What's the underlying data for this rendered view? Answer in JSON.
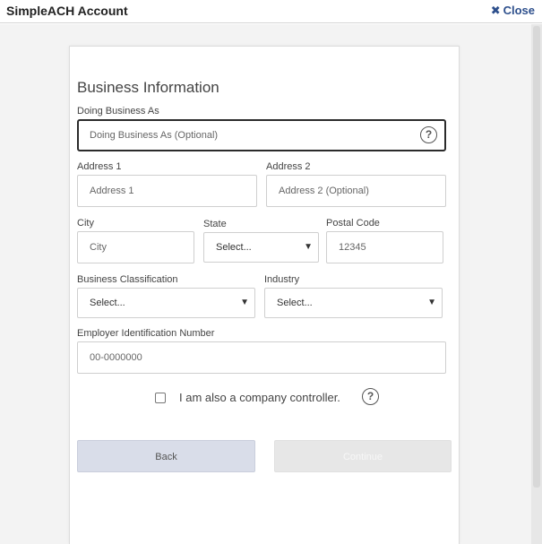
{
  "window": {
    "title": "SimpleACH Account",
    "close_label": "Close"
  },
  "form": {
    "heading": "Business Information",
    "dba": {
      "label": "Doing Business As",
      "placeholder": "Doing Business As (Optional)"
    },
    "address1": {
      "label": "Address 1",
      "placeholder": "Address 1"
    },
    "address2": {
      "label": "Address 2",
      "placeholder": "Address 2 (Optional)"
    },
    "city": {
      "label": "City",
      "placeholder": "City"
    },
    "state": {
      "label": "State",
      "value": "Select..."
    },
    "postal": {
      "label": "Postal Code",
      "placeholder": "12345"
    },
    "classification": {
      "label": "Business Classification",
      "value": "Select..."
    },
    "industry": {
      "label": "Industry",
      "value": "Select..."
    },
    "ein": {
      "label": "Employer Identification Number",
      "placeholder": "00-0000000"
    },
    "controller": {
      "label": "I am also a company controller.",
      "checked": false
    },
    "back_label": "Back",
    "continue_label": "Continue"
  },
  "icons": {
    "help": "question-circle-icon",
    "chevron": "chevron-down-icon",
    "close": "x-icon"
  }
}
